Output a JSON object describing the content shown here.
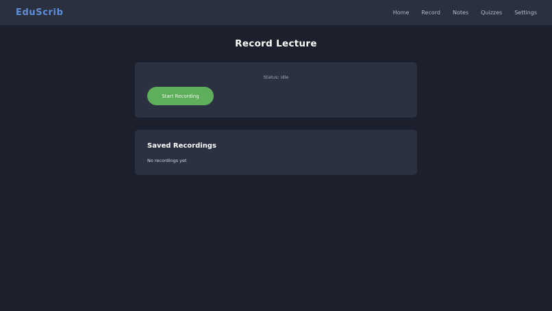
{
  "nav": {
    "brand": "EduScrib",
    "links": [
      "Home",
      "Record",
      "Notes",
      "Quizzes",
      "Settings"
    ]
  },
  "page": {
    "title": "Record Lecture"
  },
  "recorder": {
    "status": "Status: idle",
    "button_label": "Start Recording"
  },
  "saved": {
    "title": "Saved Recordings",
    "empty_message": "No recordings yet"
  },
  "colors": {
    "background": "#1c1f2c",
    "navbar": "#2b303f",
    "card": "#2c3142",
    "brand": "#5f8fd8",
    "record_button": "#5fae5c"
  }
}
